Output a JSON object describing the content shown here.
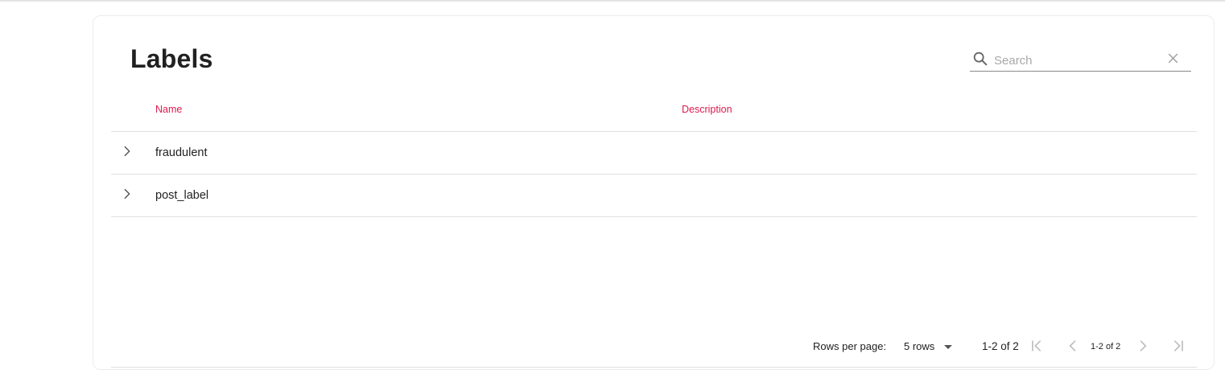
{
  "page": {
    "title": "Labels"
  },
  "search": {
    "placeholder": "Search",
    "value": "",
    "icon": "search-icon",
    "clear_icon": "close-icon"
  },
  "table": {
    "columns": [
      "Name",
      "Description"
    ],
    "rows": [
      {
        "name": "fraudulent",
        "description": ""
      },
      {
        "name": "post_label",
        "description": ""
      }
    ]
  },
  "pagination": {
    "rows_per_page_label": "Rows per page:",
    "rows_per_page_value": "5 rows",
    "range_text": "1-2 of 2",
    "page_indicator": "1-2 of 2"
  },
  "colors": {
    "header_accent": "#e0194d",
    "divider": "#e0e0e0",
    "disabled_icon": "#bdbdbd"
  }
}
